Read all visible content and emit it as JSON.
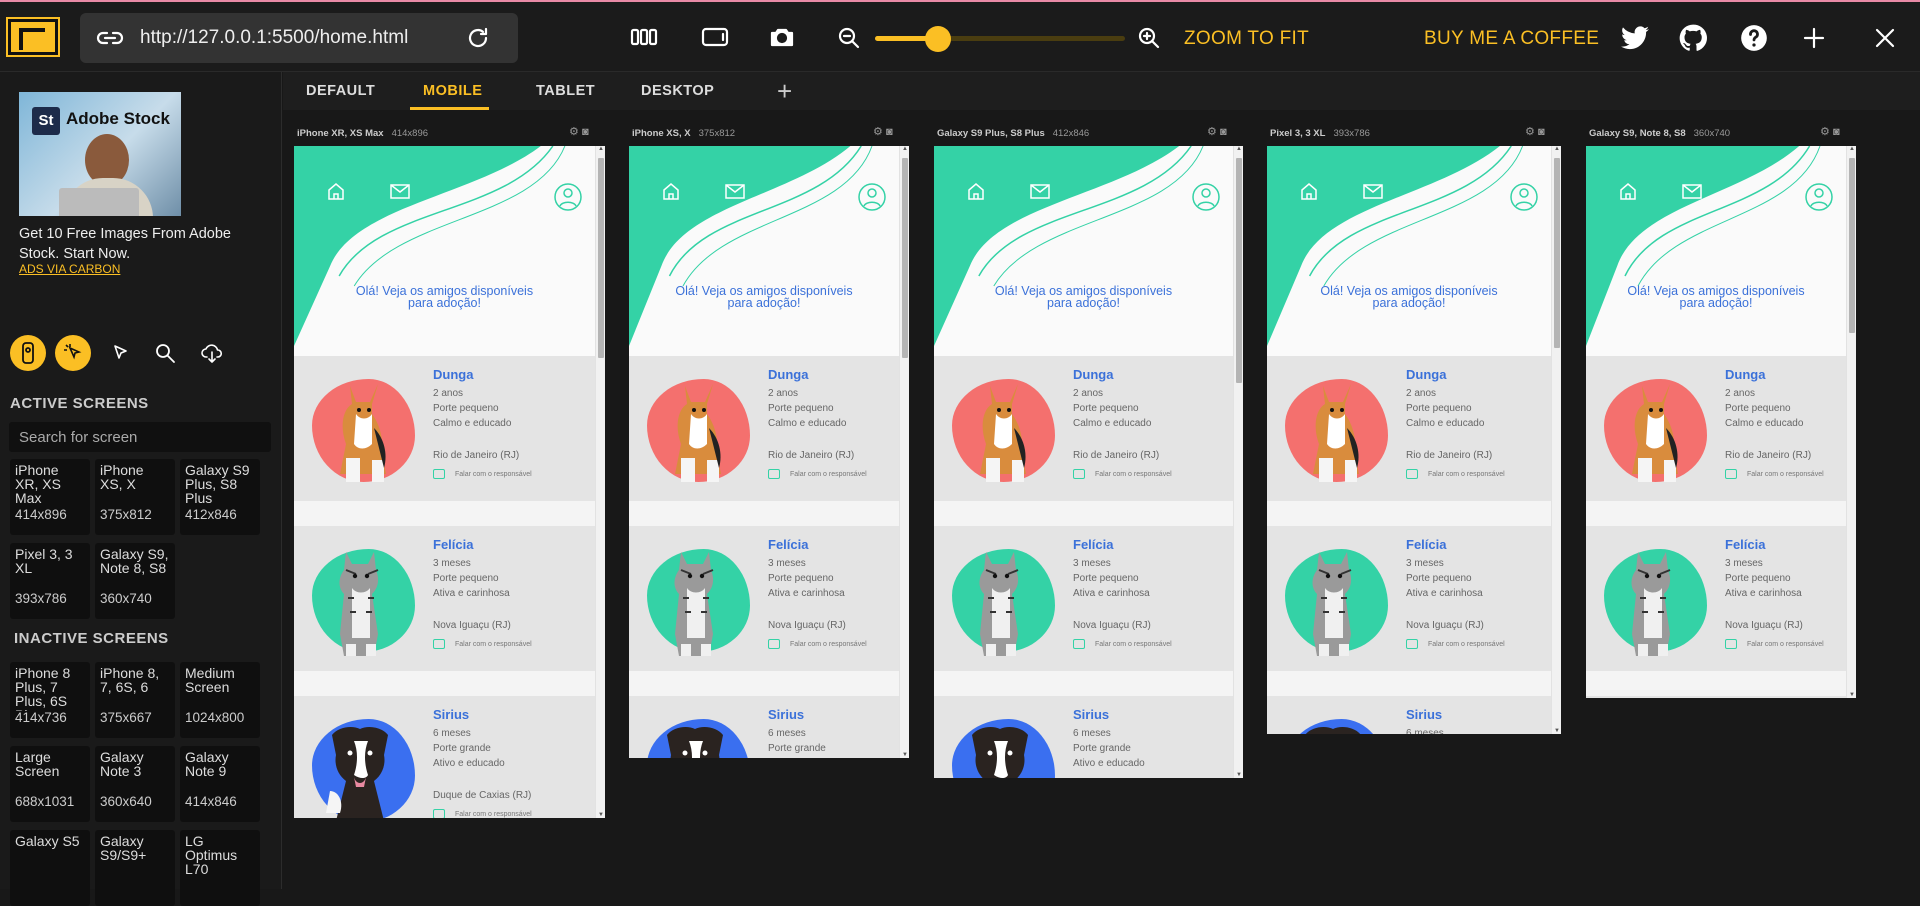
{
  "toolbar": {
    "url": "http://127.0.0.1:5500/home.html",
    "zoom_to_fit": "ZOOM TO FIT",
    "buy_coffee": "BUY ME A COFFEE",
    "zoom_level": 0.25,
    "accent": "#fbbf24"
  },
  "ad": {
    "brand": "Adobe Stock",
    "logo_letters": "St",
    "text": "Get 10 Free Images From Adobe Stock. Start Now.",
    "link": "ADS VIA CARBON"
  },
  "sidebar": {
    "active_title": "ACTIVE SCREENS",
    "inactive_title": "INACTIVE SCREENS",
    "search_placeholder": "Search for screen",
    "active": [
      {
        "name": "iPhone XR, XS Max",
        "size": "414x896"
      },
      {
        "name": "iPhone XS, X",
        "size": "375x812"
      },
      {
        "name": "Galaxy S9 Plus, S8 Plus",
        "size": "412x846"
      },
      {
        "name": "Pixel 3, 3 XL",
        "size": "393x786"
      },
      {
        "name": "Galaxy S9, Note 8, S8",
        "size": "360x740"
      }
    ],
    "inactive": [
      {
        "name": "iPhone 8 Plus, 7 Plus, 6S Plus",
        "size": "414x736"
      },
      {
        "name": "iPhone 8, 7, 6S, 6",
        "size": "375x667"
      },
      {
        "name": "Medium Screen",
        "size": "1024x800"
      },
      {
        "name": "Large Screen",
        "size": "688x1031"
      },
      {
        "name": "Galaxy Note 3",
        "size": "360x640"
      },
      {
        "name": "Galaxy Note 9",
        "size": "414x846"
      },
      {
        "name": "Galaxy S5",
        "size": ""
      },
      {
        "name": "Galaxy S9/S9+",
        "size": ""
      },
      {
        "name": "LG Optimus L70",
        "size": ""
      }
    ]
  },
  "tabs": [
    "DEFAULT",
    "MOBILE",
    "TABLET",
    "DESKTOP"
  ],
  "active_tab": "MOBILE",
  "devices": [
    {
      "name": "iPhone XR, XS Max",
      "size": "414x896"
    },
    {
      "name": "iPhone XS, X",
      "size": "375x812"
    },
    {
      "name": "Galaxy S9 Plus, S8 Plus",
      "size": "412x846"
    },
    {
      "name": "Pixel 3, 3 XL",
      "size": "393x786"
    },
    {
      "name": "Galaxy S9, Note 8, S8",
      "size": "360x740"
    }
  ],
  "site": {
    "greeting": "Olá! Veja os amigos disponíveis para adoção!",
    "chat": "Falar com o responsável",
    "pets": [
      {
        "name": "Dunga",
        "age": "2 anos",
        "size": "Porte pequeno",
        "temper": "Calmo e educado",
        "city": "Rio de Janeiro (RJ)",
        "color": "#f4706e"
      },
      {
        "name": "Felícia",
        "age": "3 meses",
        "size": "Porte pequeno",
        "temper": "Ativa e carinhosa",
        "city": "Nova Iguaçu (RJ)",
        "color": "#34d2a6"
      },
      {
        "name": "Sirius",
        "age": "6 meses",
        "size": "Porte grande",
        "temper": "Ativo e educado",
        "city": "Duque de Caxias (RJ)",
        "color": "#3a6ff0"
      }
    ]
  }
}
